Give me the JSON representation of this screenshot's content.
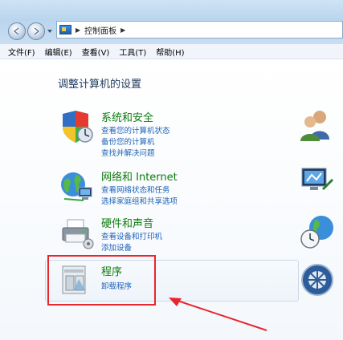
{
  "address": {
    "path": "控制面板"
  },
  "menu": [
    "文件(F)",
    "编辑(E)",
    "查看(V)",
    "工具(T)",
    "帮助(H)"
  ],
  "page_title": "调整计算机的设置",
  "categories": [
    {
      "title": "系统和安全",
      "links": [
        "查看您的计算机状态",
        "备份您的计算机",
        "查找并解决问题"
      ]
    },
    {
      "title": "网络和 Internet",
      "links": [
        "查看网络状态和任务",
        "选择家庭组和共享选项"
      ]
    },
    {
      "title": "硬件和声音",
      "links": [
        "查看设备和打印机",
        "添加设备"
      ]
    },
    {
      "title": "程序",
      "links": [
        "卸载程序"
      ]
    }
  ],
  "colors": {
    "title_green": "#0e7a0d",
    "link_blue": "#1e62b8",
    "highlight": "#e8262d"
  }
}
